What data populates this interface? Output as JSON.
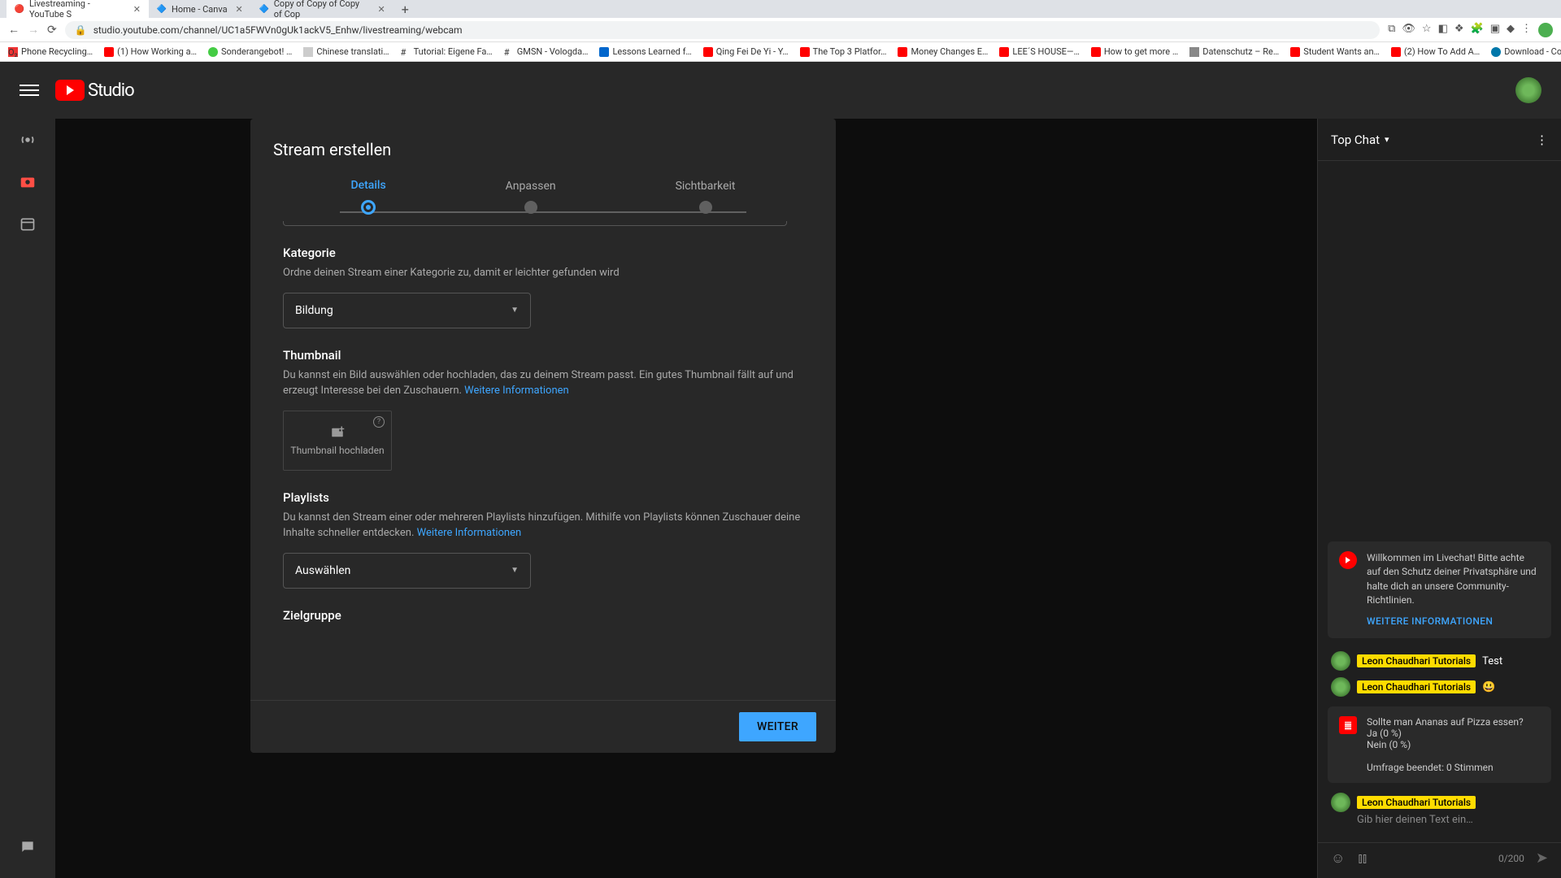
{
  "browser": {
    "tabs": [
      {
        "title": "Livestreaming - YouTube S",
        "icon": "🔴"
      },
      {
        "title": "Home - Canva",
        "icon": "🔷"
      },
      {
        "title": "Copy of Copy of Copy of Cop",
        "icon": "🔷"
      }
    ],
    "url": "studio.youtube.com/channel/UC1a5FWVn0gUk1ackV5_Enhw/livestreaming/webcam",
    "bookmarks": [
      "Phone Recycling…",
      "(1) How Working a…",
      "Sonderangebot! …",
      "Chinese translati…",
      "Tutorial: Eigene Fa…",
      "GMSN - Vologda…",
      "Lessons Learned f…",
      "Qing Fei De Yi - Y…",
      "The Top 3 Platfor…",
      "Money Changes E…",
      "LEE´S HOUSE—…",
      "How to get more …",
      "Datenschutz – Re…",
      "Student Wants an…",
      "(2) How To Add A…",
      "Download - Cooki…"
    ]
  },
  "header": {
    "brand": "Studio"
  },
  "chat": {
    "title": "Top Chat",
    "welcome": "Willkommen im Livechat! Bitte achte auf den Schutz deiner Privatsphäre und halte dich an unsere Community-Richtlinien.",
    "welcome_link": "WEITERE INFORMATIONEN",
    "msgs": [
      {
        "name": "Leon Chaudhari Tutorials",
        "text": "Test"
      },
      {
        "name": "Leon Chaudhari Tutorials",
        "text": "😃"
      }
    ],
    "poll": {
      "q": "Sollte man Ananas auf Pizza essen?",
      "a1": "Ja (0 %)",
      "a2": "Nein (0 %)",
      "end": "Umfrage beendet: 0 Stimmen"
    },
    "input_name": "Leon Chaudhari Tutorials",
    "input_placeholder": "Gib hier deinen Text ein…",
    "counter": "0/200"
  },
  "modal": {
    "title": "Stream erstellen",
    "steps": {
      "s1": "Details",
      "s2": "Anpassen",
      "s3": "Sichtbarkeit"
    },
    "kategorie": {
      "title": "Kategorie",
      "desc": "Ordne deinen Stream einer Kategorie zu, damit er leichter gefunden wird",
      "value": "Bildung"
    },
    "thumbnail": {
      "title": "Thumbnail",
      "desc": "Du kannst ein Bild auswählen oder hochladen, das zu deinem Stream passt. Ein gutes Thumbnail fällt auf und erzeugt Interesse bei den Zuschauern. ",
      "link": "Weitere Informationen",
      "upload": "Thumbnail hochladen"
    },
    "playlists": {
      "title": "Playlists",
      "desc": "Du kannst den Stream einer oder mehreren Playlists hinzufügen. Mithilfe von Playlists können Zuschauer deine Inhalte schneller entdecken. ",
      "link": "Weitere Informationen",
      "value": "Auswählen"
    },
    "zielgruppe": {
      "title": "Zielgruppe"
    },
    "next": "WEITER"
  }
}
